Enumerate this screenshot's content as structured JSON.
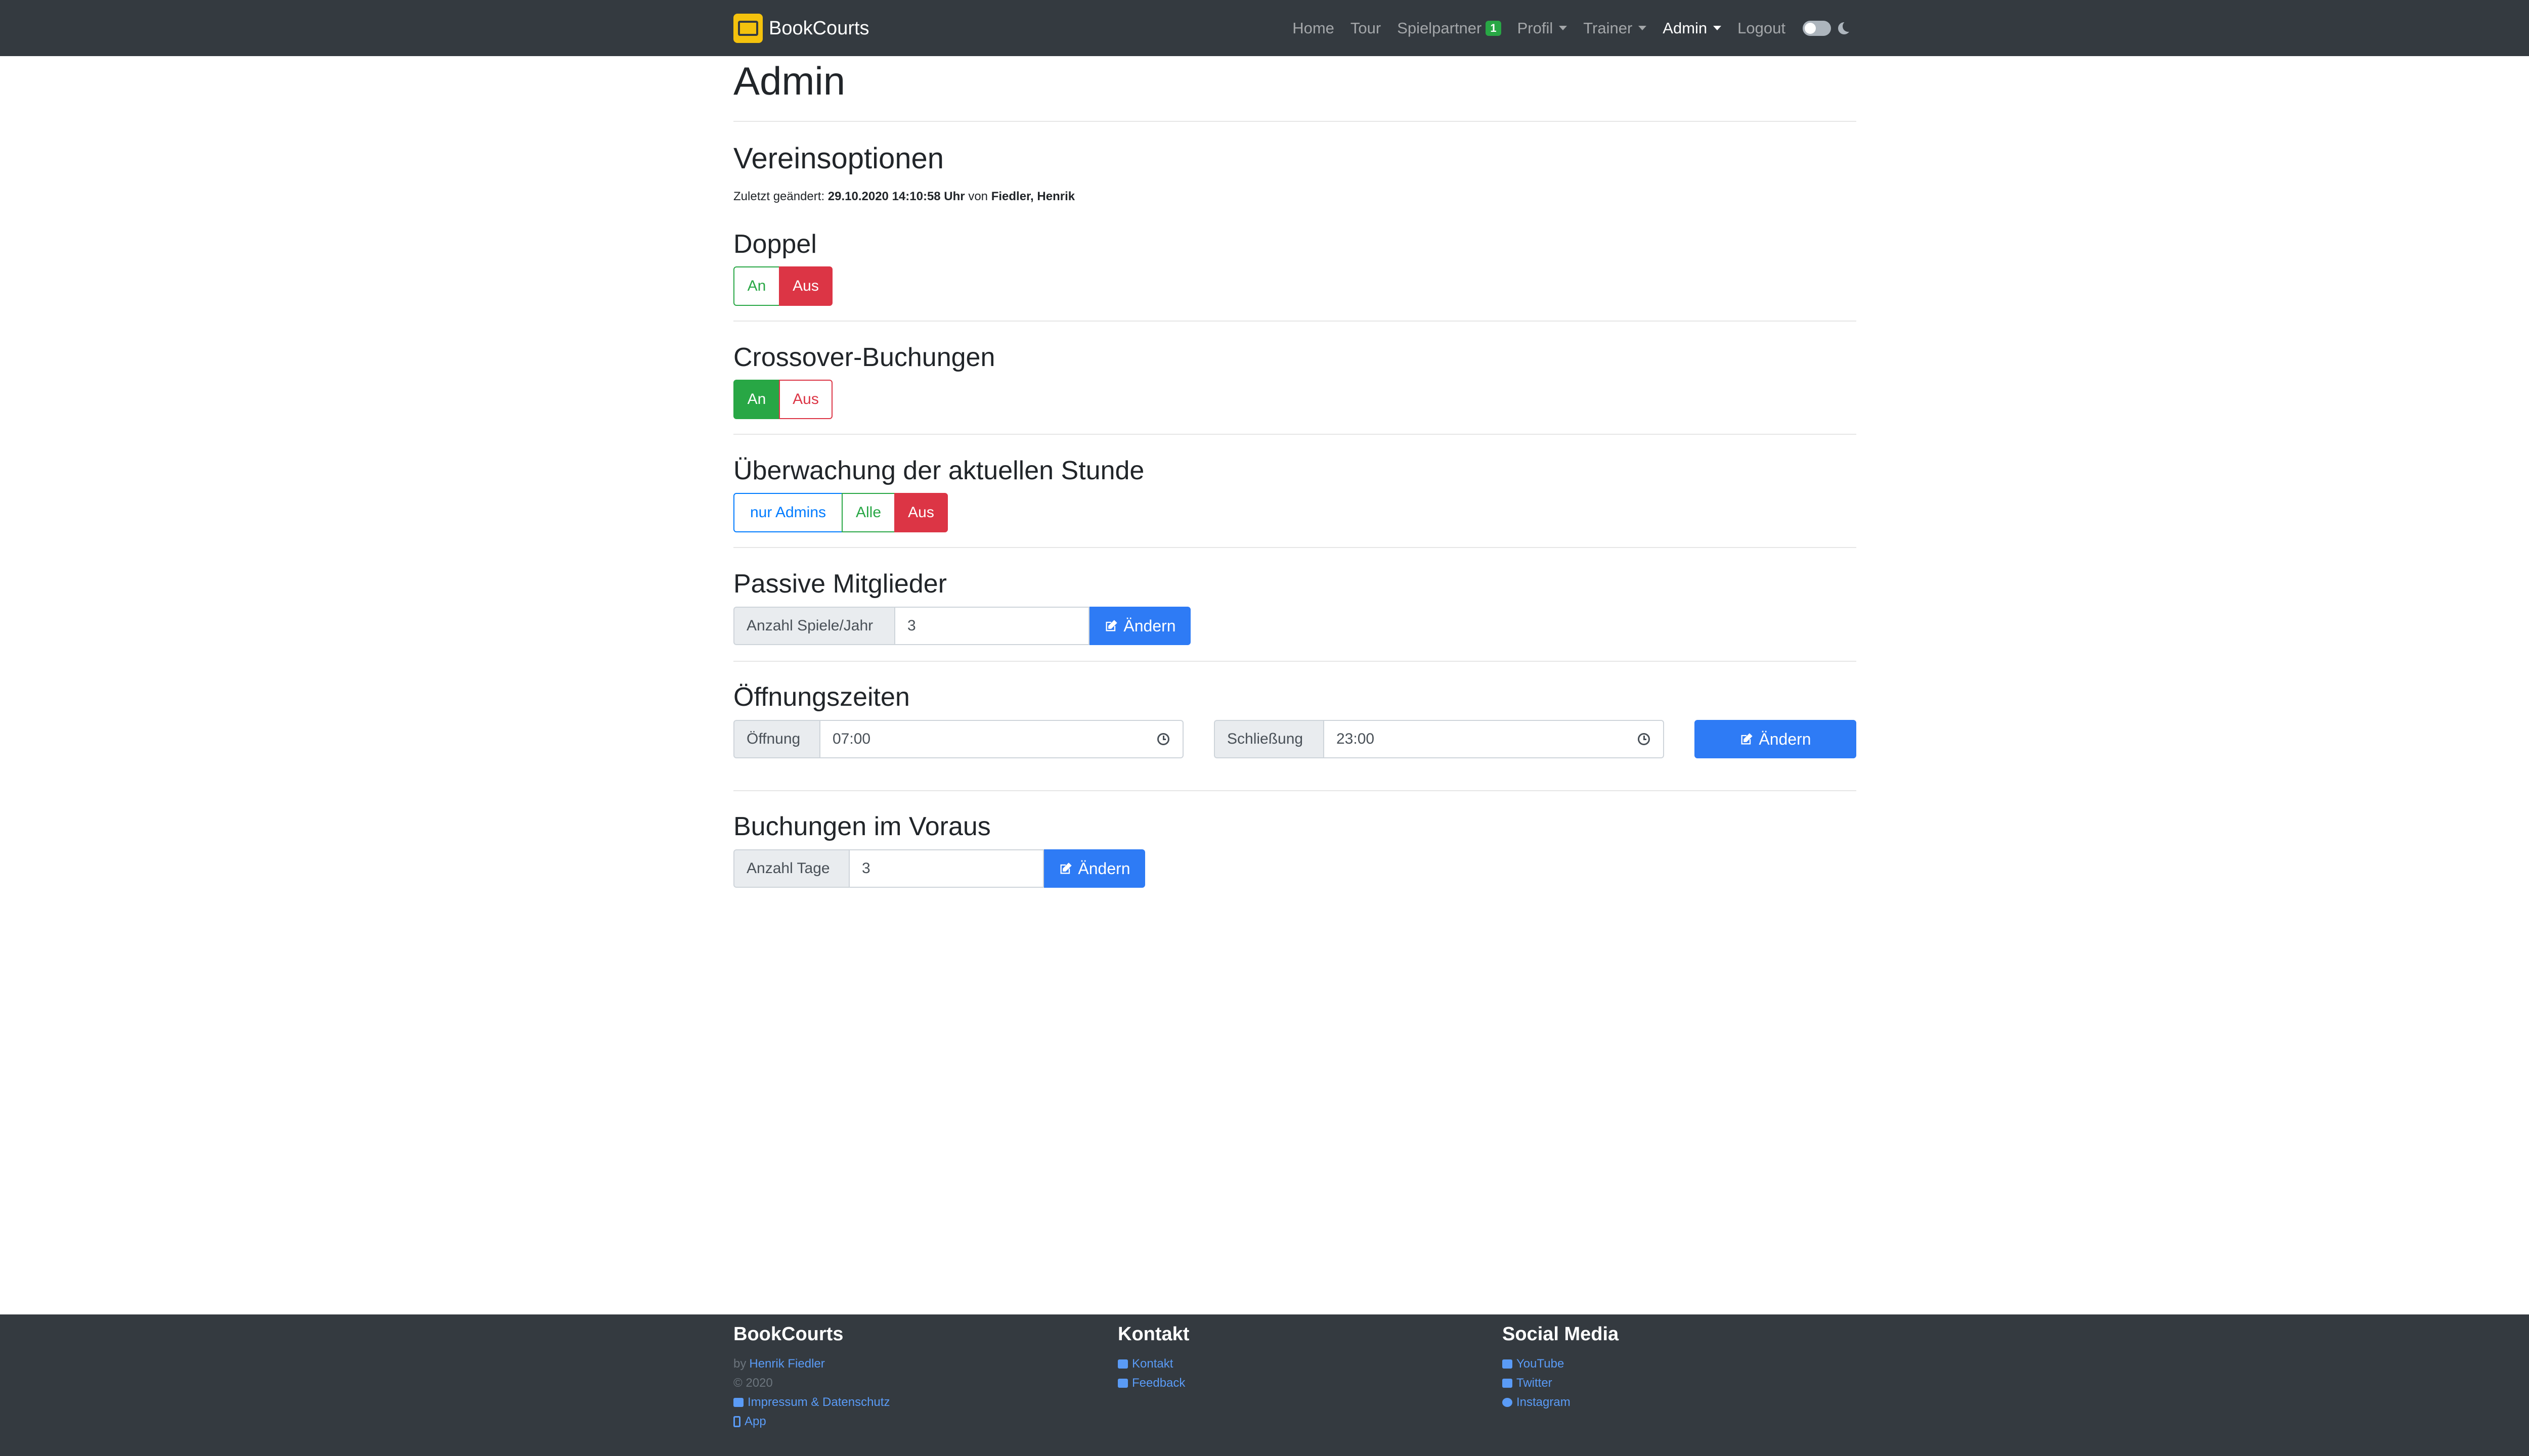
{
  "navbar": {
    "brand": "BookCourts",
    "items": [
      {
        "label": "Home"
      },
      {
        "label": "Tour"
      },
      {
        "label": "Spielpartner",
        "badge": "1"
      },
      {
        "label": "Profil"
      },
      {
        "label": "Trainer"
      },
      {
        "label": "Admin"
      },
      {
        "label": "Logout"
      }
    ]
  },
  "page": {
    "title": "Admin",
    "section_title": "Vereinsoptionen",
    "last_change": {
      "prefix": "Zuletzt geändert:",
      "datetime": "29.10.2020 14:10:58 Uhr",
      "by_word": "von",
      "user": "Fiedler, Henrik"
    },
    "doppel": {
      "title": "Doppel",
      "on": "An",
      "off": "Aus",
      "active": "off"
    },
    "crossover": {
      "title": "Crossover-Buchungen",
      "on": "An",
      "off": "Aus",
      "active": "on"
    },
    "monitoring": {
      "title": "Überwachung der aktuellen Stunde",
      "admins": "nur Admins",
      "all": "Alle",
      "off": "Aus",
      "active": "off"
    },
    "passive": {
      "title": "Passive Mitglieder",
      "label": "Anzahl Spiele/Jahr",
      "value": "3",
      "button": "Ändern"
    },
    "hours": {
      "title": "Öffnungszeiten",
      "open_label": "Öffnung",
      "open_value": "07:00",
      "close_label": "Schließung",
      "close_value": "23:00",
      "button": "Ändern"
    },
    "advance": {
      "title": "Buchungen im Voraus",
      "label": "Anzahl Tage",
      "value": "3",
      "button": "Ändern"
    }
  },
  "footer": {
    "col1": {
      "title": "BookCourts",
      "by": "by",
      "author": "Henrik Fiedler",
      "copyright": "© 2020",
      "impressum": "Impressum & Datenschutz",
      "app": "App"
    },
    "col2": {
      "title": "Kontakt",
      "contact": "Kontakt",
      "feedback": "Feedback"
    },
    "col3": {
      "title": "Social Media",
      "youtube": "YouTube",
      "twitter": "Twitter",
      "instagram": "Instagram"
    }
  },
  "colors": {
    "navbar": "#343a40",
    "success": "#28a745",
    "danger": "#dc3545",
    "primary": "#2e7bf5",
    "link": "#5a9bf6"
  }
}
